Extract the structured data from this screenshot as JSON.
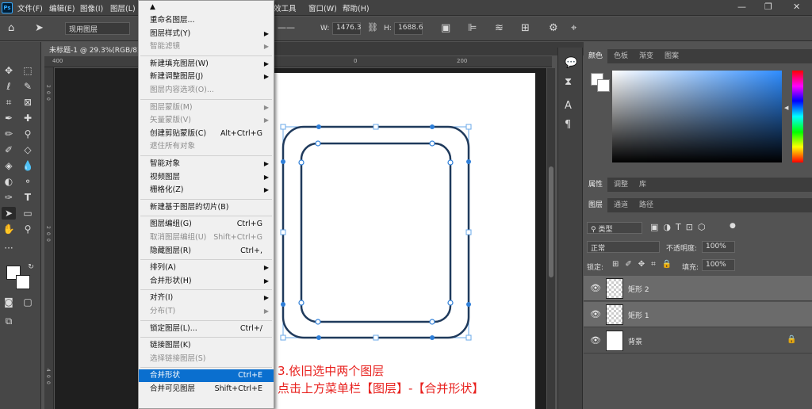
{
  "menubar": {
    "logo": "Ps",
    "items": [
      "文件(F)",
      "编辑(E)",
      "图像(I)",
      "图层(L)",
      "效工具",
      "窗口(W)",
      "帮助(H)"
    ]
  },
  "options": {
    "layer_select": "现用图层",
    "w_label": "W:",
    "w_value": "1476.3",
    "h_label": "H:",
    "h_value": "1688.6"
  },
  "document": {
    "tab_title": "未标题-1 @ 29.3%(RGB/8)"
  },
  "rulers": {
    "h_ticks": [
      "400",
      "200",
      "0",
      "200"
    ],
    "v_ticks": [
      "2",
      "0",
      "0",
      "2",
      "0",
      "0",
      "4",
      "0",
      "0"
    ]
  },
  "menu": {
    "items": [
      {
        "label": "重命名图层...",
        "shortcut": "",
        "submenu": false,
        "disabled": false
      },
      {
        "label": "图层样式(Y)",
        "shortcut": "",
        "submenu": true,
        "disabled": false
      },
      {
        "label": "智能滤镜",
        "shortcut": "",
        "submenu": true,
        "disabled": true
      },
      {
        "label": "新建填充图层(W)",
        "shortcut": "",
        "submenu": true,
        "disabled": false
      },
      {
        "label": "新建调整图层(J)",
        "shortcut": "",
        "submenu": true,
        "disabled": false
      },
      {
        "label": "图层内容选项(O)...",
        "shortcut": "",
        "submenu": false,
        "disabled": true
      },
      {
        "label": "图层蒙版(M)",
        "shortcut": "",
        "submenu": true,
        "disabled": true
      },
      {
        "label": "矢量蒙版(V)",
        "shortcut": "",
        "submenu": true,
        "disabled": true
      },
      {
        "label": "创建剪贴蒙版(C)",
        "shortcut": "Alt+Ctrl+G",
        "submenu": false,
        "disabled": false
      },
      {
        "label": "遮住所有对象",
        "shortcut": "",
        "submenu": false,
        "disabled": true
      },
      {
        "label": "智能对象",
        "shortcut": "",
        "submenu": true,
        "disabled": false
      },
      {
        "label": "视频图层",
        "shortcut": "",
        "submenu": true,
        "disabled": false
      },
      {
        "label": "栅格化(Z)",
        "shortcut": "",
        "submenu": true,
        "disabled": false
      },
      {
        "label": "新建基于图层的切片(B)",
        "shortcut": "",
        "submenu": false,
        "disabled": false
      },
      {
        "label": "图层编组(G)",
        "shortcut": "Ctrl+G",
        "submenu": false,
        "disabled": false
      },
      {
        "label": "取消图层编组(U)",
        "shortcut": "Shift+Ctrl+G",
        "submenu": false,
        "disabled": true
      },
      {
        "label": "隐藏图层(R)",
        "shortcut": "Ctrl+,",
        "submenu": false,
        "disabled": false
      },
      {
        "label": "排列(A)",
        "shortcut": "",
        "submenu": true,
        "disabled": false
      },
      {
        "label": "合并形状(H)",
        "shortcut": "",
        "submenu": true,
        "disabled": false
      },
      {
        "label": "对齐(I)",
        "shortcut": "",
        "submenu": true,
        "disabled": false
      },
      {
        "label": "分布(T)",
        "shortcut": "",
        "submenu": true,
        "disabled": true
      },
      {
        "label": "锁定图层(L)...",
        "shortcut": "Ctrl+/",
        "submenu": false,
        "disabled": false
      },
      {
        "label": "链接图层(K)",
        "shortcut": "",
        "submenu": false,
        "disabled": false
      },
      {
        "label": "选择链接图层(S)",
        "shortcut": "",
        "submenu": false,
        "disabled": true
      },
      {
        "label": "合并形状",
        "shortcut": "Ctrl+E",
        "submenu": false,
        "disabled": false,
        "highlighted": true
      },
      {
        "label": "合并可见图层",
        "shortcut": "Shift+Ctrl+E",
        "submenu": false,
        "disabled": false
      }
    ]
  },
  "annotation": {
    "line1": "3.依旧选中两个图层",
    "line2": "点击上方菜单栏【图层】-【合并形状】",
    "color": "#e8211e"
  },
  "color_panel": {
    "tabs": [
      "颜色",
      "色板",
      "渐变",
      "图案"
    ]
  },
  "properties_panel": {
    "tabs": [
      "属性",
      "调整",
      "库"
    ]
  },
  "layers_panel": {
    "tabs": [
      "图层",
      "通道",
      "路径"
    ],
    "filter_type": "类型",
    "blend_mode": "正常",
    "opacity_label": "不透明度:",
    "opacity_value": "100%",
    "lock_label": "锁定:",
    "fill_label": "填充:",
    "fill_value": "100%",
    "layers": [
      {
        "name": "矩形 2",
        "selected": true,
        "locked": false
      },
      {
        "name": "矩形 1",
        "selected": true,
        "locked": false
      },
      {
        "name": "背景",
        "selected": false,
        "locked": true
      }
    ]
  },
  "colors": {
    "highlight": "#0a6fcf",
    "path_stroke": "#1f3a5c",
    "handle": "#2f7fd8"
  }
}
